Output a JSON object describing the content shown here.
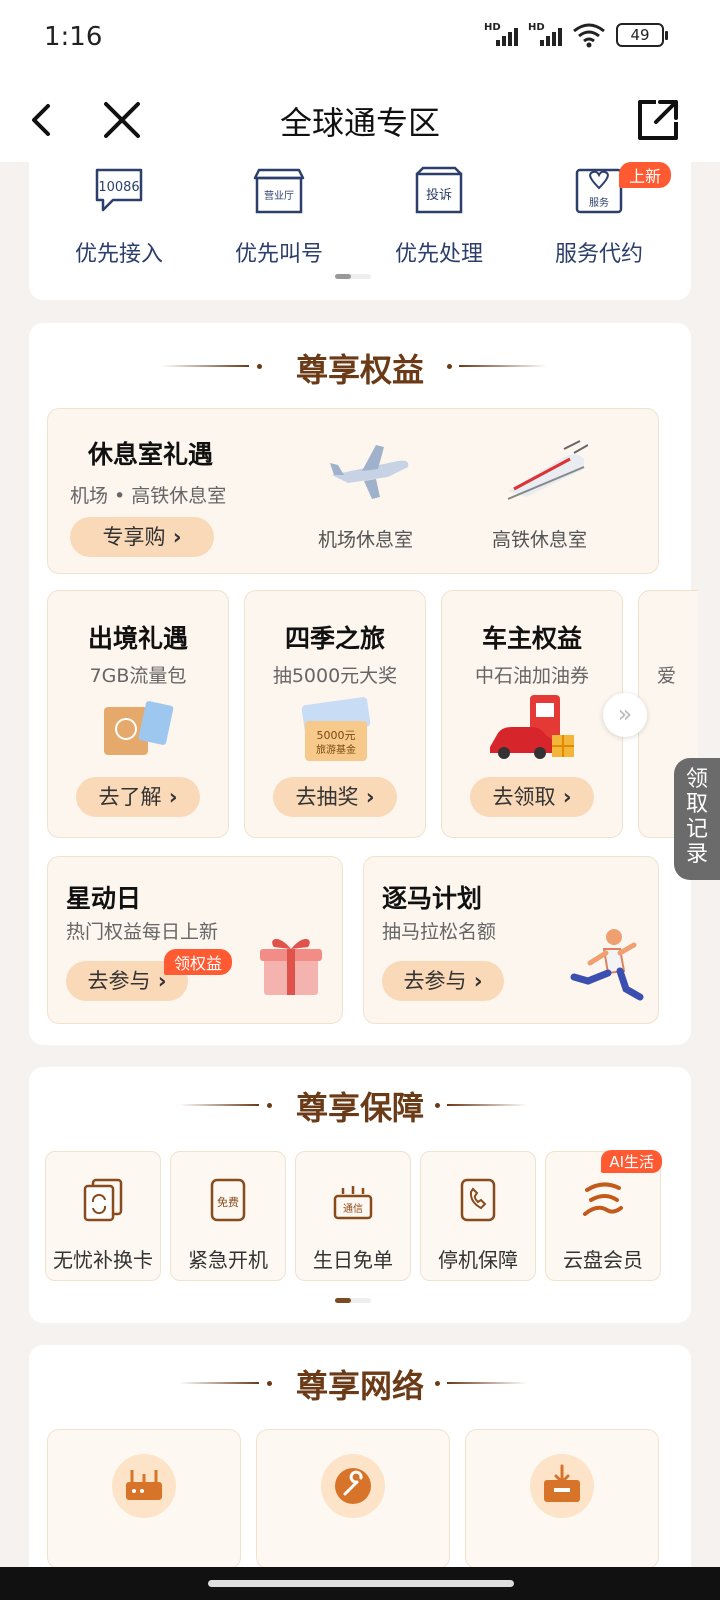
{
  "status": {
    "time": "1:16",
    "battery": "49",
    "hd": "HD"
  },
  "nav": {
    "title": "全球通专区"
  },
  "top_icons": [
    {
      "label": "优先接入",
      "icon": "10086",
      "badge": ""
    },
    {
      "label": "优先叫号",
      "icon": "营业厅",
      "badge": ""
    },
    {
      "label": "优先处理",
      "icon": "投诉",
      "badge": ""
    },
    {
      "label": "服务代约",
      "icon": "服务",
      "badge": "上新"
    }
  ],
  "rights": {
    "title": "尊享权益",
    "lounge": {
      "title": "休息室礼遇",
      "subtitle": "机场 • 高铁休息室",
      "button": "专享购",
      "airport_label": "机场休息室",
      "train_label": "高铁休息室"
    },
    "tiles": [
      {
        "title": "出境礼遇",
        "subtitle": "7GB流量包",
        "button": "去了解"
      },
      {
        "title": "四季之旅",
        "subtitle": "抽5000元大奖",
        "button": "去抽奖",
        "voucher_text": "5000元",
        "voucher_sub": "旅游基金"
      },
      {
        "title": "车主权益",
        "subtitle": "中石油加油券",
        "button": "去领取"
      },
      {
        "title": "",
        "subtitle": "爱",
        "button": ""
      }
    ],
    "star": {
      "title": "星动日",
      "subtitle": "热门权益每日上新",
      "button": "去参与",
      "badge": "领权益"
    },
    "marathon": {
      "title": "逐马计划",
      "subtitle": "抽马拉松名额",
      "button": "去参与"
    }
  },
  "guarantee": {
    "title": "尊享保障",
    "items": [
      {
        "label": "无忧补换卡",
        "badge": ""
      },
      {
        "label": "紧急开机",
        "badge": "",
        "icon_text": "免费"
      },
      {
        "label": "生日免单",
        "badge": "",
        "icon_text": "通信"
      },
      {
        "label": "停机保障",
        "badge": ""
      },
      {
        "label": "云盘会员",
        "badge": "AI生活"
      }
    ]
  },
  "network": {
    "title": "尊享网络"
  },
  "side_tab": {
    "label": "领取记录"
  },
  "colors": {
    "accent": "#6b3a17",
    "badge": "#ff5a32",
    "icon_blue": "#2c3f6b"
  }
}
